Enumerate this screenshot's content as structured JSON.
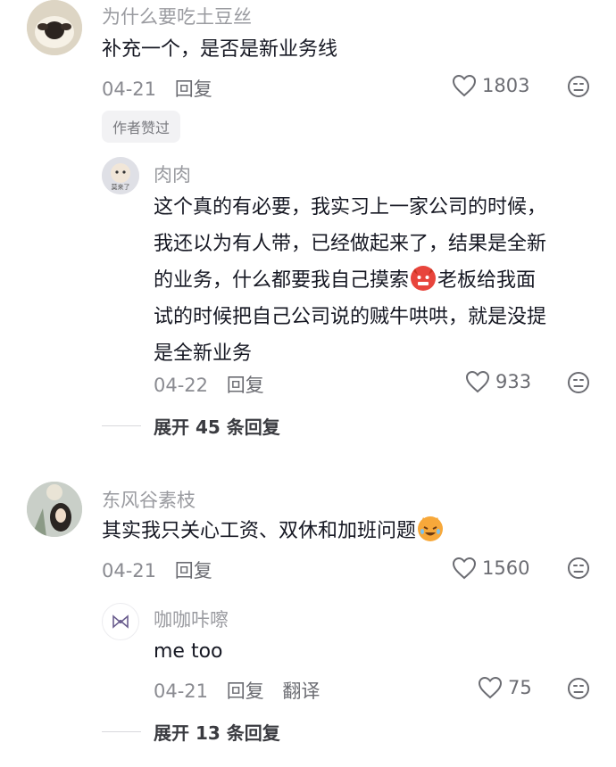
{
  "comments": [
    {
      "username": "为什么要吃土豆丝",
      "text": "补充一个，是否是新业务线",
      "date": "04-21",
      "reply_label": "回复",
      "likes": "1803",
      "badge": "作者赞过",
      "replies": [
        {
          "username": "肉肉",
          "avatar_text": "莫来了",
          "lines": [
            "这个真的有必要，我实习上一家公司的时候，",
            "我还以为有人带，已经做起来了，结果是全新",
            "的业务，什么都要我自己摸索",
            "老板给我面",
            "试的时候把自己公司说的贼牛哄哄，就是没提",
            "是全新业务"
          ],
          "date": "04-22",
          "reply_label": "回复",
          "likes": "933"
        }
      ],
      "expand_label": "展开 45 条回复"
    },
    {
      "username": "东风谷素枝",
      "text": "其实我只关心工资、双休和加班问题",
      "date": "04-21",
      "reply_label": "回复",
      "likes": "1560",
      "replies": [
        {
          "username": "咖咖咔嚓",
          "text": "me too",
          "date": "04-21",
          "reply_label": "回复",
          "translate_label": "翻译",
          "likes": "75"
        }
      ],
      "expand_label": "展开 13 条回复"
    }
  ],
  "icons": {
    "like": "heart-outline-icon",
    "dislike": "unhappy-face-icon",
    "devil_emoji": "angry-devil-emoji",
    "cat_emoji": "crying-laughing-cat-emoji"
  },
  "colors": {
    "text": "#161823",
    "muted": "#9a9ba0",
    "badge_bg": "#f2f2f4"
  }
}
